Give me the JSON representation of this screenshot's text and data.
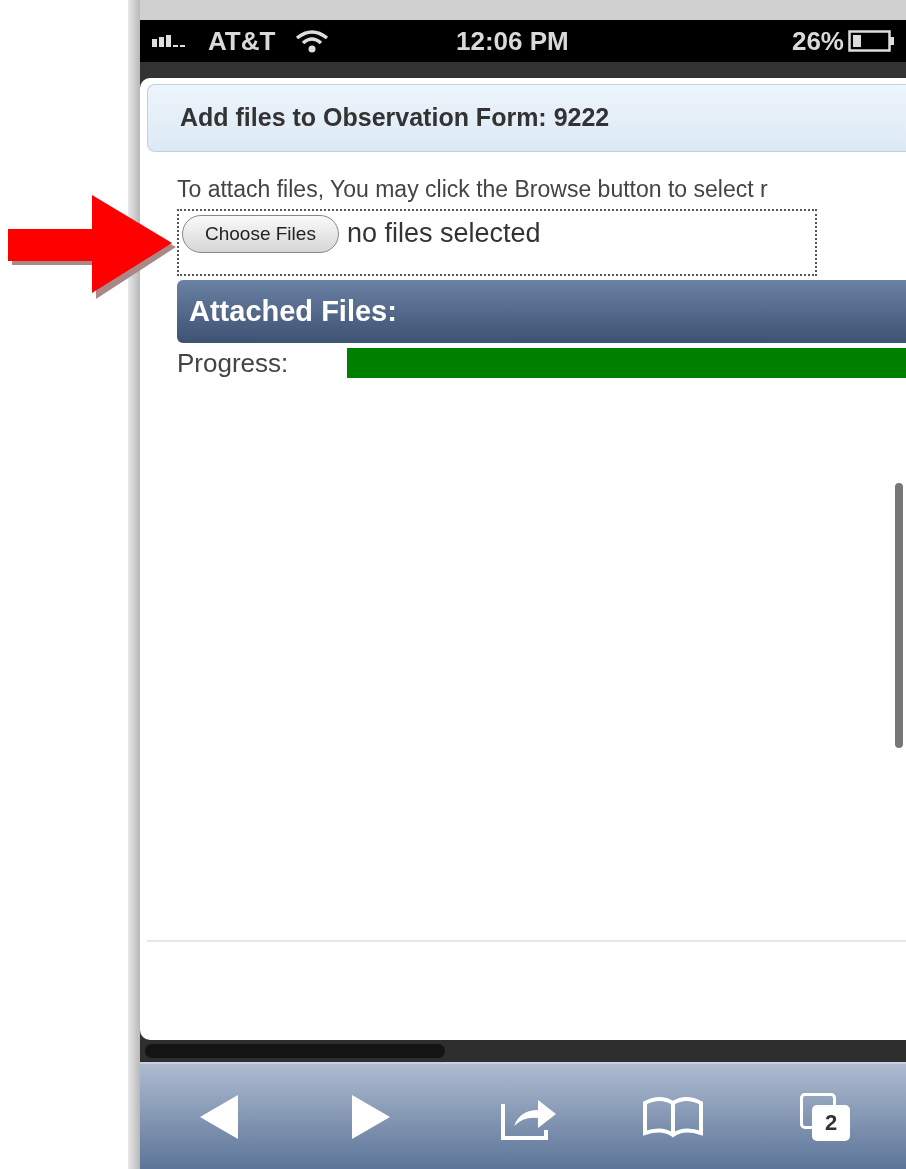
{
  "status_bar": {
    "carrier": "AT&T",
    "time": "12:06 PM",
    "battery": "26%"
  },
  "page": {
    "title": "Add files to Observation Form: 9222",
    "instructions": "To attach files, You may click the Browse button to select r",
    "file_input": {
      "button": "Choose Files",
      "value": "no files selected"
    },
    "attached_header": "Attached Files:",
    "progress": {
      "label": "Progress:"
    }
  },
  "toolbar": {
    "tabs_count": "2"
  }
}
